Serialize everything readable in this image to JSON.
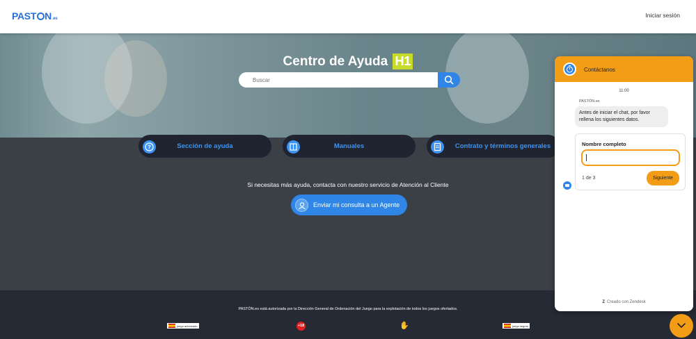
{
  "header": {
    "logo_text": "PASTÓN",
    "logo_pre": "PAST",
    "logo_post": "N",
    "logo_tld": ".es",
    "login_label": "Iniciar sesión"
  },
  "hero": {
    "title": "Centro de Ayuda",
    "badge": "H1",
    "search_placeholder": "Buscar"
  },
  "cards": [
    {
      "label": "Sección de ayuda",
      "icon": "question-icon"
    },
    {
      "label": "Manuales",
      "icon": "book-icon"
    },
    {
      "label": "Contrato y términos generales",
      "icon": "document-icon"
    }
  ],
  "help": {
    "text": "Si necesitas más ayuda, contacta con nuestro servicio de Atención al Cliente",
    "agent_button": "Enviar mi consulta a un Agente"
  },
  "footer": {
    "text": "PASTÓN.es está autorizada por la Dirección General de Ordenación del Juego para la explotación de todos los juegos ofertados.",
    "badge_autorizado": "juego autorizado",
    "badge_age": "+18",
    "badge_seguro": "juego seguro"
  },
  "chat": {
    "title": "Contáctanos",
    "time": "11:00",
    "sender": "PASTÓN.es",
    "message": "Antes de iniciar el chat, por favor rellena los siguientes datos.",
    "field_label": "Nombre completo",
    "field_value": "",
    "step": "1 de 3",
    "next_button": "Siguiente",
    "powered_by": "Creado con Zendesk"
  },
  "colors": {
    "brand_blue": "#2f86e6",
    "accent_orange": "#f39c16",
    "badge_lime": "#c7dc2a"
  }
}
